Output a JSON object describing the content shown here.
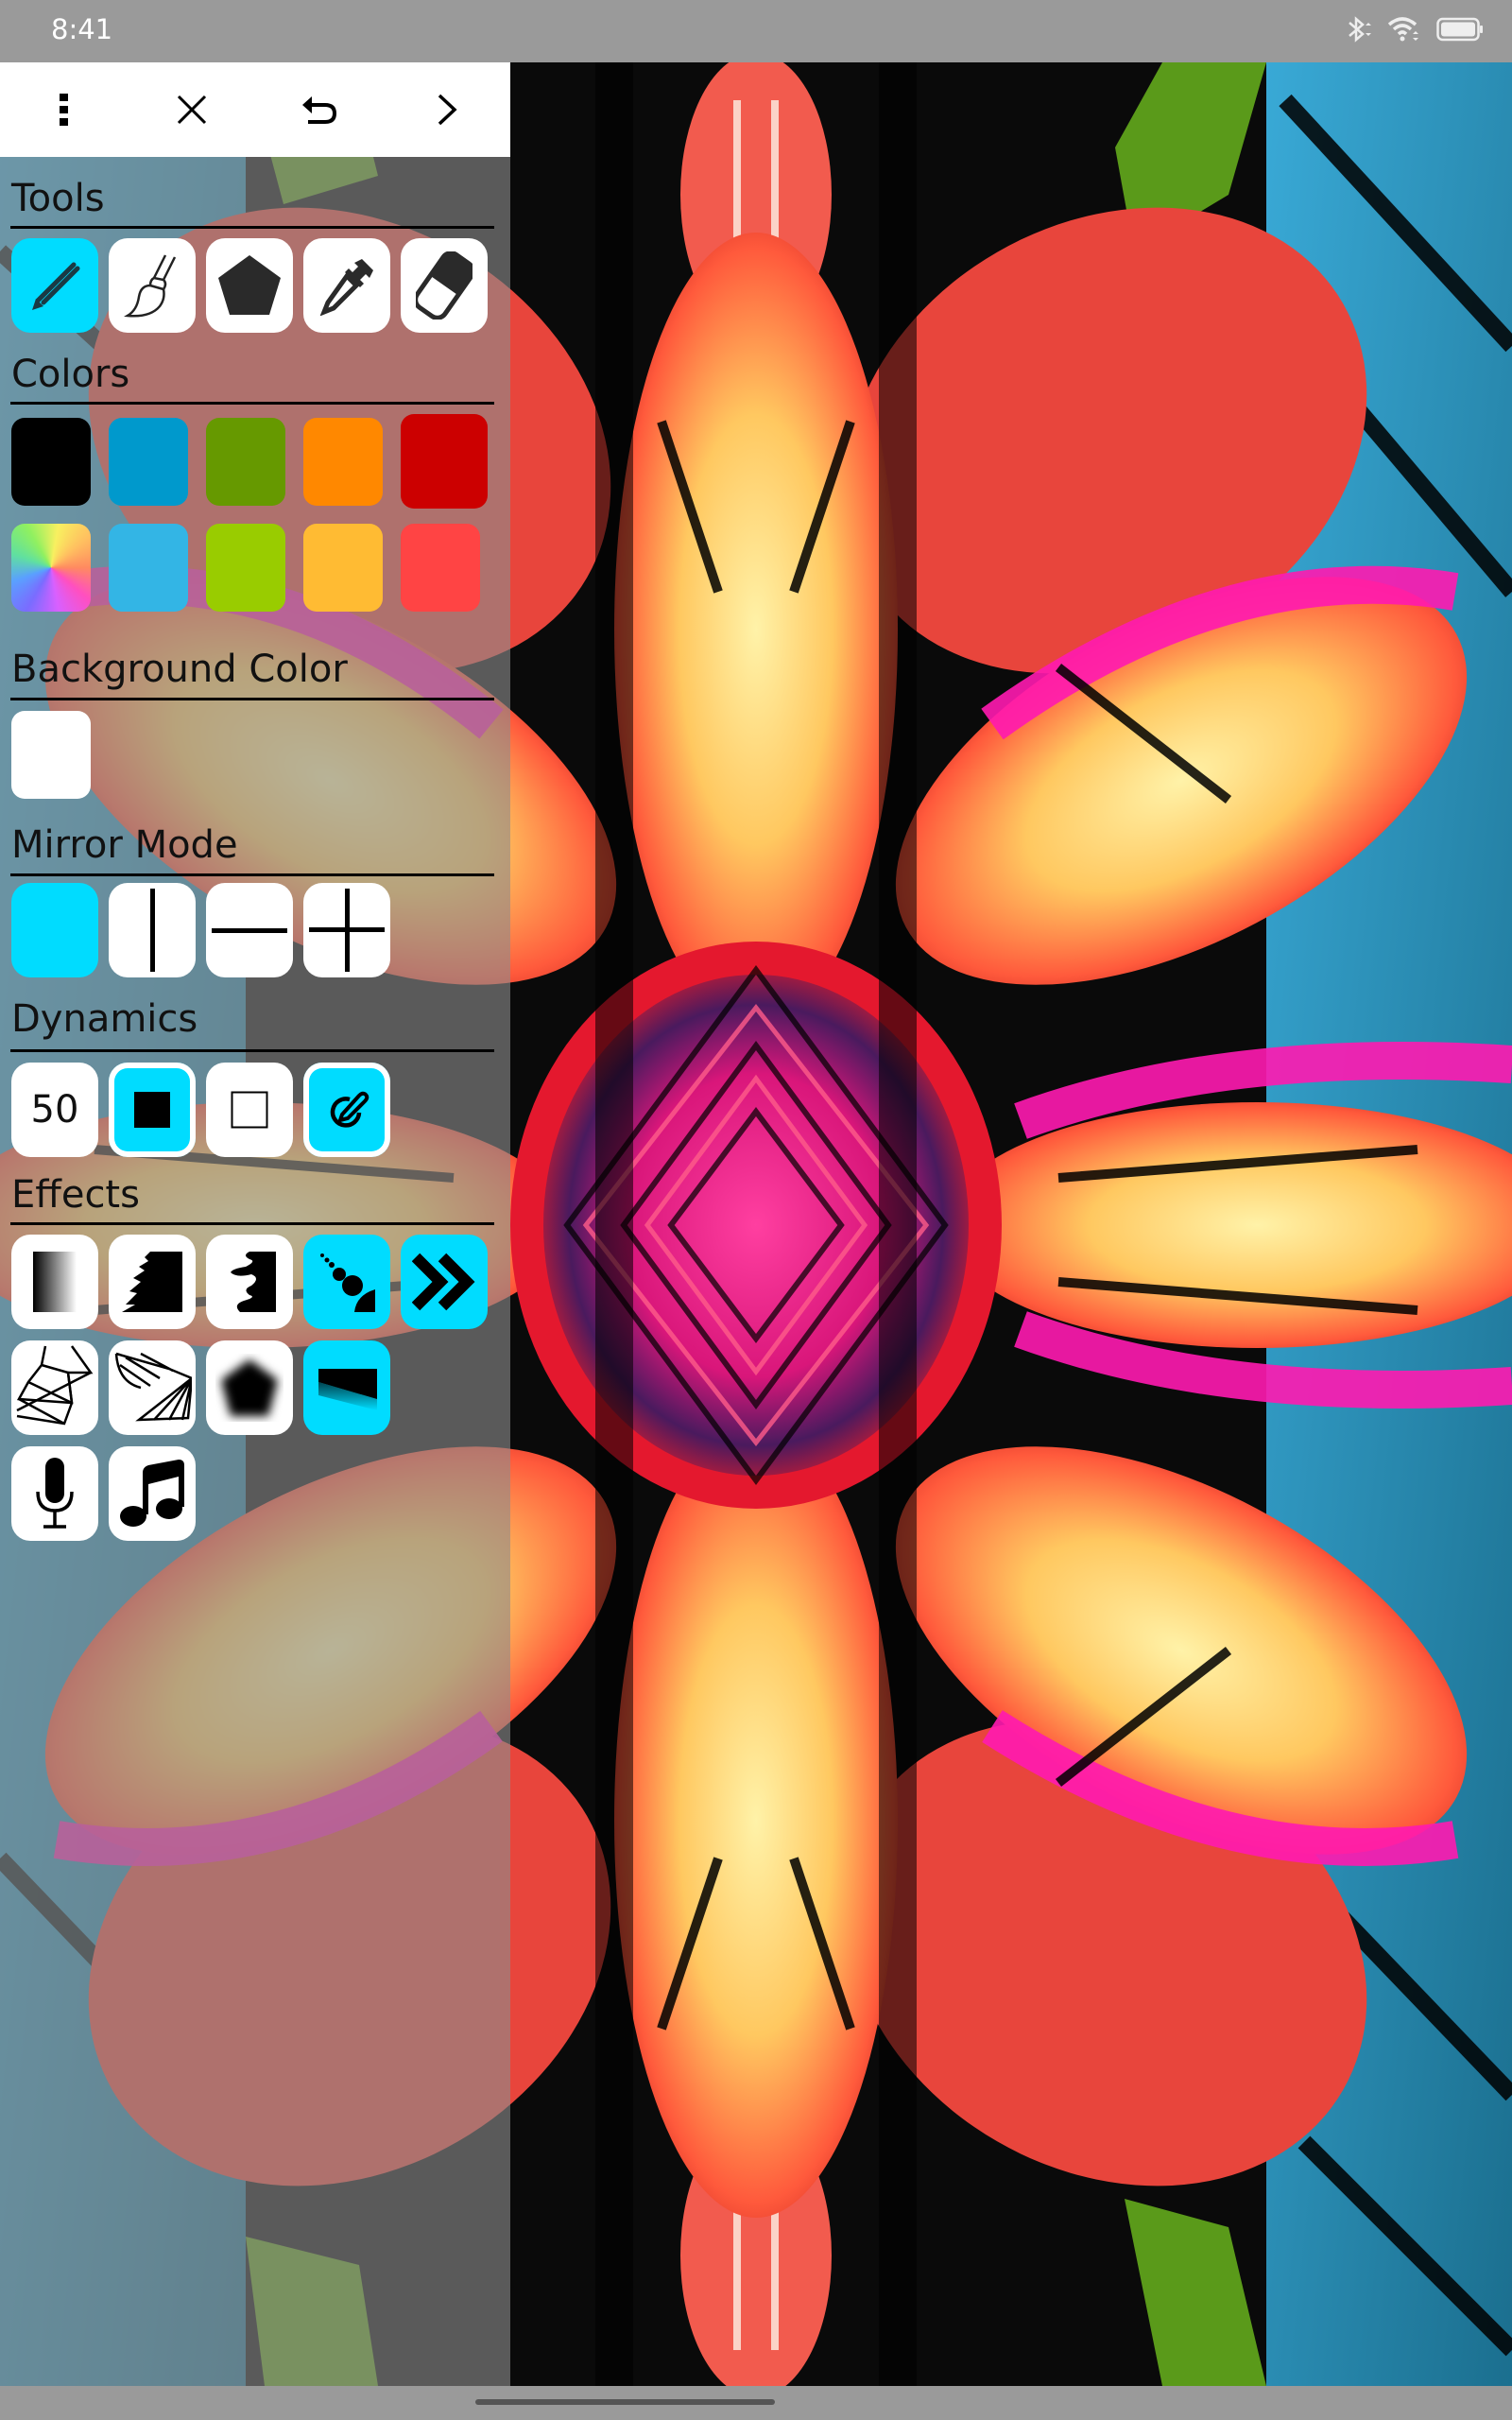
{
  "status_bar": {
    "time": "8:41",
    "icons": [
      "bluetooth-icon",
      "wifi-icon",
      "battery-icon"
    ]
  },
  "toolbar": {
    "buttons": [
      {
        "name": "more-options",
        "icon": "more-vert-icon"
      },
      {
        "name": "close",
        "icon": "close-icon"
      },
      {
        "name": "undo",
        "icon": "undo-icon"
      },
      {
        "name": "next",
        "icon": "chevron-right-icon"
      }
    ]
  },
  "panel": {
    "sections": {
      "tools": "Tools",
      "colors": "Colors",
      "background_color": "Background Color",
      "mirror_mode": "Mirror Mode",
      "dynamics": "Dynamics",
      "effects": "Effects"
    },
    "tools": [
      {
        "name": "pencil",
        "icon": "pencil-icon",
        "active": true
      },
      {
        "name": "brush",
        "icon": "brush-icon",
        "active": false
      },
      {
        "name": "shape",
        "icon": "pentagon-icon",
        "active": false
      },
      {
        "name": "eyedropper",
        "icon": "eyedropper-icon",
        "active": false
      },
      {
        "name": "eraser",
        "icon": "eraser-icon",
        "active": false
      }
    ],
    "colors": [
      [
        "#000000",
        "#0099cc",
        "#669900",
        "#ff8800",
        "#cc0000"
      ],
      [
        "rainbow",
        "#33b5e5",
        "#99cc00",
        "#ffbb33",
        "#ff4444"
      ]
    ],
    "selected_color": "#cc0000",
    "background_color": "#ffffff",
    "mirror_modes": [
      {
        "name": "none",
        "active": true
      },
      {
        "name": "vertical",
        "active": false
      },
      {
        "name": "horizontal",
        "active": false
      },
      {
        "name": "quad",
        "active": false
      }
    ],
    "dynamics": {
      "size_value": "50",
      "items": [
        {
          "name": "size",
          "active": false
        },
        {
          "name": "fill",
          "icon": "filled-square-icon",
          "active": true
        },
        {
          "name": "outline",
          "icon": "outline-square-icon",
          "active": false
        },
        {
          "name": "pressure",
          "icon": "stylus-icon",
          "active": true
        }
      ]
    },
    "effects": [
      {
        "name": "gradient",
        "icon": "gradient-icon",
        "active": false
      },
      {
        "name": "spiky",
        "icon": "spiky-edge-icon",
        "active": false
      },
      {
        "name": "drip",
        "icon": "drip-icon",
        "active": false
      },
      {
        "name": "scatter",
        "icon": "scatter-dots-icon",
        "active": true
      },
      {
        "name": "speed",
        "icon": "double-chevron-icon",
        "active": true
      },
      {
        "name": "web",
        "icon": "web-lines-icon",
        "active": false
      },
      {
        "name": "fan",
        "icon": "fan-lines-icon",
        "active": false
      },
      {
        "name": "blur",
        "icon": "blurred-pentagon-icon",
        "active": false
      },
      {
        "name": "shadow",
        "icon": "shadow-icon",
        "active": true
      },
      {
        "name": "microphone",
        "icon": "microphone-icon",
        "active": false
      },
      {
        "name": "music",
        "icon": "music-note-icon",
        "active": false
      }
    ]
  }
}
